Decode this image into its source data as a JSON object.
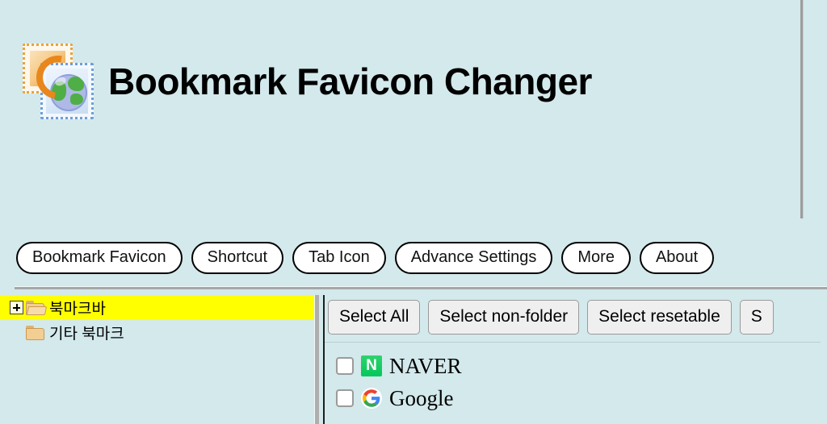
{
  "app": {
    "title": "Bookmark Favicon Changer",
    "logo_icon": "stamp-globe-icon",
    "background_color": "#d3e9ec"
  },
  "tabs": [
    {
      "label": "Bookmark Favicon",
      "name": "tab-bookmark-favicon"
    },
    {
      "label": "Shortcut",
      "name": "tab-shortcut"
    },
    {
      "label": "Tab Icon",
      "name": "tab-tab-icon"
    },
    {
      "label": "Advance Settings",
      "name": "tab-advance-settings"
    },
    {
      "label": "More",
      "name": "tab-more"
    },
    {
      "label": "About",
      "name": "tab-about"
    }
  ],
  "tree": {
    "nodes": [
      {
        "label": "북마크바",
        "icon": "folder-open-icon",
        "expander": "plus-box-icon",
        "selected": true,
        "highlight_color": "#ffff00"
      },
      {
        "label": "기타 북마크",
        "icon": "folder-closed-icon",
        "selected": false
      }
    ]
  },
  "toolbar": {
    "buttons": [
      {
        "label": "Select All",
        "name": "select-all-button"
      },
      {
        "label": "Select non-folder",
        "name": "select-non-folder-button"
      },
      {
        "label": "Select resetable",
        "name": "select-resetable-button"
      },
      {
        "label": "S",
        "name": "select-clipped-button",
        "clipped": true
      }
    ]
  },
  "bookmarks": {
    "items": [
      {
        "label": "NAVER",
        "icon": "naver-favicon",
        "icon_glyph": "N",
        "icon_color": "#03c75a",
        "checked": false
      },
      {
        "label": "Google",
        "icon": "google-favicon",
        "icon_glyph": "G",
        "icon_color": "#4285f4",
        "checked": false
      }
    ]
  }
}
